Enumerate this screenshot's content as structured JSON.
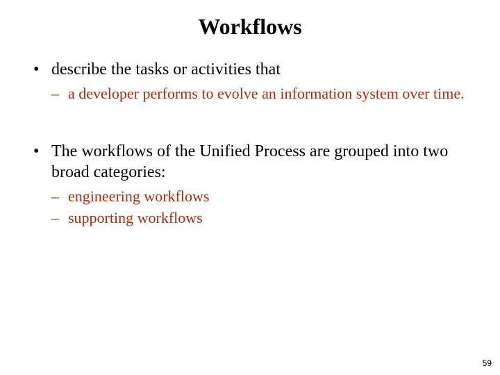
{
  "title": "Workflows",
  "bullets": [
    {
      "text": "describe the tasks or activities that",
      "subs": [
        "a developer performs to evolve an information system over time."
      ]
    },
    {
      "text": "The workflows of the Unified Process are grouped into two broad categories:",
      "subs": [
        "engineering workflows",
        "supporting workflows"
      ]
    }
  ],
  "subColor": "#b22a0a",
  "pageNumber": "59"
}
